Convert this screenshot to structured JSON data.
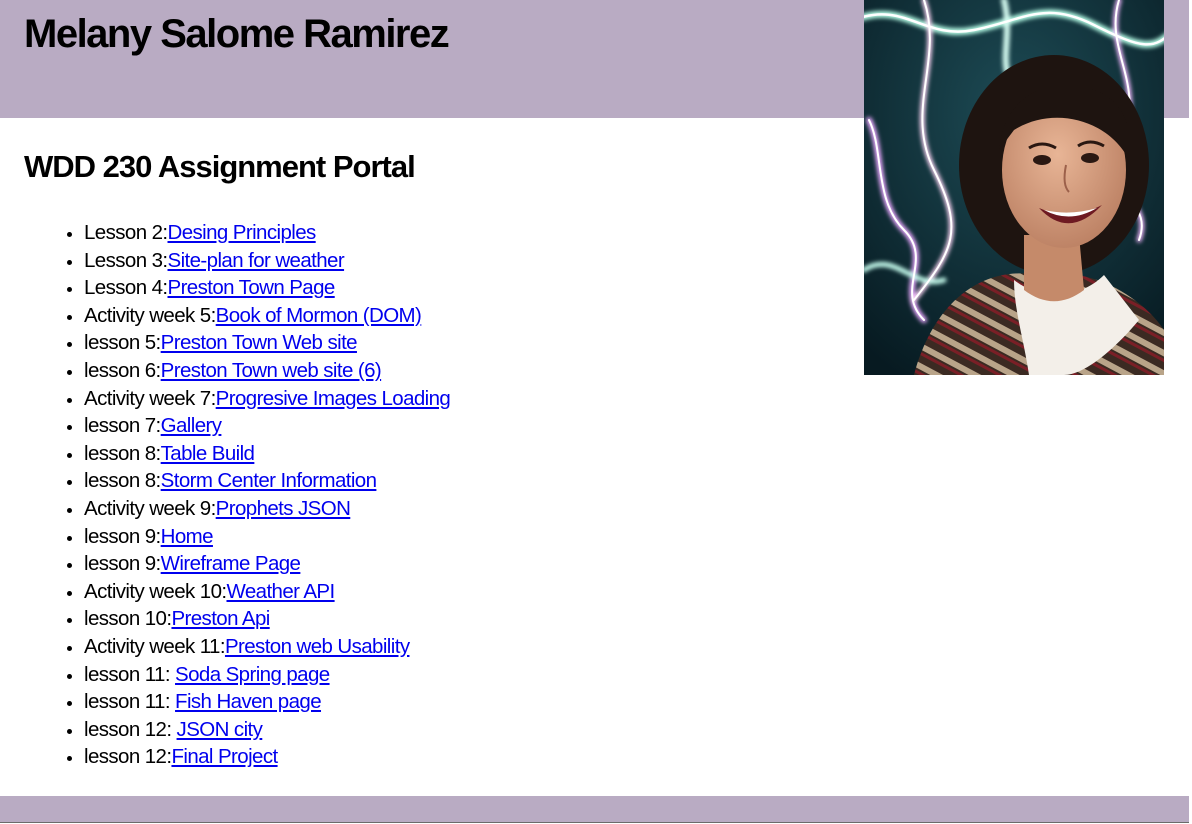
{
  "header": {
    "title": "Melany Salome Ramirez"
  },
  "main": {
    "heading": "WDD 230 Assignment Portal",
    "lessons": [
      {
        "label": "Lesson 2:",
        "link": "Desing Principles"
      },
      {
        "label": "Lesson 3:",
        "link": "Site-plan for weather"
      },
      {
        "label": "Lesson 4:",
        "link": "Preston Town Page"
      },
      {
        "label": "Activity week 5:",
        "link": "Book of Mormon (DOM)"
      },
      {
        "label": "lesson 5:",
        "link": "Preston Town Web site"
      },
      {
        "label": "lesson 6:",
        "link": "Preston Town web site (6)"
      },
      {
        "label": "Activity week 7:",
        "link": "Progresive Images Loading"
      },
      {
        "label": "lesson 7:",
        "link": "Gallery"
      },
      {
        "label": "lesson 8:",
        "link": "Table Build"
      },
      {
        "label": "lesson 8:",
        "link": "Storm Center Information"
      },
      {
        "label": "Activity week 9:",
        "link": "Prophets JSON"
      },
      {
        "label": "lesson 9:",
        "link": "Home"
      },
      {
        "label": "lesson 9:",
        "link": "Wireframe Page"
      },
      {
        "label": "Activity week 10:",
        "link": "Weather API"
      },
      {
        "label": "lesson 10:",
        "link": "Preston Api"
      },
      {
        "label": "Activity week 11:",
        "link": "Preston web Usability"
      },
      {
        "label": "lesson 11: ",
        "link": "Soda Spring page"
      },
      {
        "label": "lesson 11: ",
        "link": "Fish Haven page"
      },
      {
        "label": "lesson 12: ",
        "link": "JSON city"
      },
      {
        "label": "lesson 12:",
        "link": "Final Project"
      }
    ]
  },
  "colors": {
    "header_bg": "#b9abc3",
    "link": "#0000ee",
    "text": "#000000"
  },
  "photo": {
    "icon": "profile-photo"
  }
}
